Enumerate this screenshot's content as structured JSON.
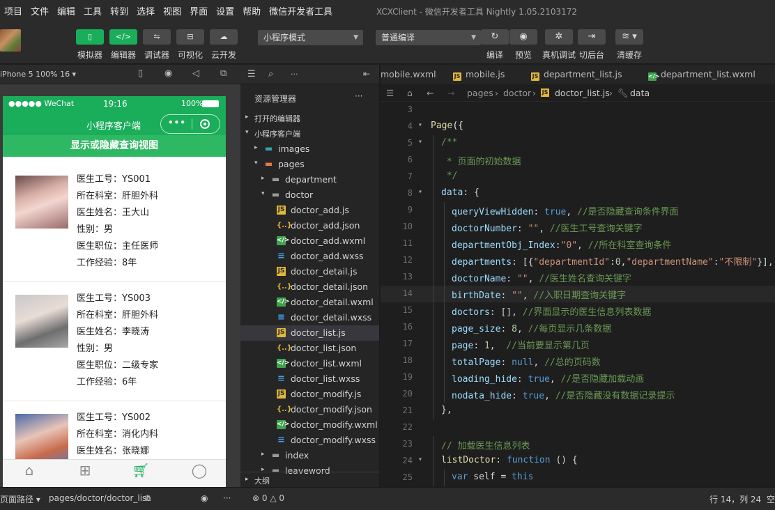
{
  "menu": {
    "items": [
      "项目",
      "文件",
      "编辑",
      "工具",
      "转到",
      "选择",
      "视图",
      "界面",
      "设置",
      "帮助",
      "微信开发者工具"
    ],
    "window_title": "XCXClient - 微信开发者工具 Nightly 1.05.2103172"
  },
  "toolbar": {
    "left_tools": [
      {
        "label": "模拟器",
        "icon": "phone-icon",
        "active": true
      },
      {
        "label": "编辑器",
        "icon": "code-icon",
        "active": true
      },
      {
        "label": "调试器",
        "icon": "debug-icon",
        "active": false
      },
      {
        "label": "可视化",
        "icon": "visual-icon",
        "active": false
      },
      {
        "label": "云开发",
        "icon": "cloud-icon",
        "active": false
      }
    ],
    "mode_select": "小程序模式",
    "compile_select": "普通编译",
    "right_tools": [
      {
        "label": "编译",
        "icon": "refresh-icon"
      },
      {
        "label": "预览",
        "icon": "eye-icon"
      },
      {
        "label": "真机调试",
        "icon": "bug-icon"
      },
      {
        "label": "切后台",
        "icon": "switch-icon"
      },
      {
        "label": "清缓存",
        "icon": "layers-icon"
      }
    ]
  },
  "simulator": {
    "device": "iPhone 5 100% 16 ▾",
    "status": {
      "carrier": "●●●●● WeChat",
      "time": "19:16",
      "battery": "100%"
    },
    "nav_title": "小程序客户端",
    "toggle_label": "显示或隐藏查询视图",
    "doctors": [
      {
        "lines": [
          "医生工号：YS001",
          "所在科室：肝胆外科",
          "医生姓名：王大山",
          "性别：男",
          "医生职位：主任医师",
          "工作经验：8年"
        ]
      },
      {
        "lines": [
          "医生工号：YS003",
          "所在科室：肝胆外科",
          "医生姓名：李晓涛",
          "性别：男",
          "医生职位：二级专家",
          "工作经验：6年"
        ]
      },
      {
        "lines": [
          "医生工号：YS002",
          "所在科室：消化内科",
          "医生姓名：张晓娜"
        ]
      }
    ]
  },
  "explorer": {
    "title": "资源管理器",
    "more": "···",
    "sections": {
      "open_editors": "打开的编辑器",
      "project": "小程序客户端",
      "outline": "大纲"
    },
    "tree": [
      {
        "name": "images",
        "type": "images",
        "depth": 1,
        "arrow": "▸"
      },
      {
        "name": "pages",
        "type": "pages",
        "depth": 1,
        "arrow": "▾"
      },
      {
        "name": "department",
        "type": "folder",
        "depth": 2,
        "arrow": "▸"
      },
      {
        "name": "doctor",
        "type": "folder-open",
        "depth": 2,
        "arrow": "▾"
      },
      {
        "name": "doctor_add.js",
        "type": "js",
        "depth": 3
      },
      {
        "name": "doctor_add.json",
        "type": "json",
        "depth": 3
      },
      {
        "name": "doctor_add.wxml",
        "type": "wxml",
        "depth": 3
      },
      {
        "name": "doctor_add.wxss",
        "type": "wxss",
        "depth": 3
      },
      {
        "name": "doctor_detail.js",
        "type": "js",
        "depth": 3
      },
      {
        "name": "doctor_detail.json",
        "type": "json",
        "depth": 3
      },
      {
        "name": "doctor_detail.wxml",
        "type": "wxml",
        "depth": 3
      },
      {
        "name": "doctor_detail.wxss",
        "type": "wxss",
        "depth": 3
      },
      {
        "name": "doctor_list.js",
        "type": "js",
        "depth": 3,
        "selected": true
      },
      {
        "name": "doctor_list.json",
        "type": "json",
        "depth": 3
      },
      {
        "name": "doctor_list.wxml",
        "type": "wxml",
        "depth": 3
      },
      {
        "name": "doctor_list.wxss",
        "type": "wxss",
        "depth": 3
      },
      {
        "name": "doctor_modify.js",
        "type": "js",
        "depth": 3
      },
      {
        "name": "doctor_modify.json",
        "type": "json",
        "depth": 3
      },
      {
        "name": "doctor_modify.wxml",
        "type": "wxml",
        "depth": 3
      },
      {
        "name": "doctor_modify.wxss",
        "type": "wxss",
        "depth": 3
      },
      {
        "name": "index",
        "type": "folder",
        "depth": 2,
        "arrow": "▸"
      },
      {
        "name": "leaveword",
        "type": "folder",
        "depth": 2,
        "arrow": "▸"
      }
    ]
  },
  "editor": {
    "tabs": [
      {
        "name": "mobile.wxml",
        "type": "wxml"
      },
      {
        "name": "mobile.js",
        "type": "js"
      },
      {
        "name": "department_list.js",
        "type": "js"
      },
      {
        "name": "department_list.wxml",
        "type": "wxml"
      }
    ],
    "breadcrumb": [
      "pages",
      "doctor",
      "doctor_list.js",
      "data"
    ],
    "lines": [
      {
        "n": "3",
        "tokens": []
      },
      {
        "n": "4",
        "fold": "▾",
        "tokens": [
          [
            "fn",
            "Page"
          ],
          [
            "pn",
            "({"
          ]
        ]
      },
      {
        "n": "5",
        "fold": "▾",
        "indent": 1,
        "tokens": [
          [
            "cm",
            "/**"
          ]
        ]
      },
      {
        "n": "6",
        "indent": 1,
        "tokens": [
          [
            "cm",
            " * 页面的初始数据"
          ]
        ]
      },
      {
        "n": "7",
        "indent": 1,
        "tokens": [
          [
            "cm",
            " */"
          ]
        ]
      },
      {
        "n": "8",
        "fold": "▾",
        "indent": 1,
        "tokens": [
          [
            "prop",
            "data"
          ],
          [
            "plain",
            ": {"
          ]
        ]
      },
      {
        "n": "9",
        "indent": 2,
        "tokens": [
          [
            "prop",
            "queryViewHidden"
          ],
          [
            "plain",
            ": "
          ],
          [
            "lit",
            "true"
          ],
          [
            "plain",
            ", "
          ],
          [
            "cm",
            "//是否隐藏查询条件界面"
          ]
        ]
      },
      {
        "n": "10",
        "indent": 2,
        "tokens": [
          [
            "prop",
            "doctorNumber"
          ],
          [
            "plain",
            ": "
          ],
          [
            "str",
            "\"\""
          ],
          [
            "plain",
            ", "
          ],
          [
            "cm",
            "//医生工号查询关键字"
          ]
        ]
      },
      {
        "n": "11",
        "indent": 2,
        "tokens": [
          [
            "prop",
            "departmentObj_Index"
          ],
          [
            "plain",
            ":"
          ],
          [
            "str",
            "\"0\""
          ],
          [
            "plain",
            ", "
          ],
          [
            "cm",
            "//所在科室查询条件"
          ]
        ]
      },
      {
        "n": "12",
        "indent": 2,
        "tokens": [
          [
            "prop",
            "departments"
          ],
          [
            "plain",
            ": [{"
          ],
          [
            "str",
            "\"departmentId\""
          ],
          [
            "plain",
            ":"
          ],
          [
            "num",
            "0"
          ],
          [
            "plain",
            ","
          ],
          [
            "str",
            "\"departmentName\""
          ],
          [
            "plain",
            ":"
          ],
          [
            "str",
            "\"不限制\""
          ],
          [
            "plain",
            "}],"
          ]
        ]
      },
      {
        "n": "13",
        "indent": 2,
        "tokens": [
          [
            "prop",
            "doctorName"
          ],
          [
            "plain",
            ": "
          ],
          [
            "str",
            "\"\""
          ],
          [
            "plain",
            ", "
          ],
          [
            "cm",
            "//医生姓名查询关键字"
          ]
        ]
      },
      {
        "n": "14",
        "indent": 2,
        "hl": true,
        "tokens": [
          [
            "prop",
            "birthDate"
          ],
          [
            "plain",
            ": "
          ],
          [
            "str",
            "\"\""
          ],
          [
            "plain",
            ", "
          ],
          [
            "cm",
            "//入职日期查询关键字"
          ]
        ]
      },
      {
        "n": "15",
        "indent": 2,
        "tokens": [
          [
            "prop",
            "doctors"
          ],
          [
            "plain",
            ": [], "
          ],
          [
            "cm",
            "//界面显示的医生信息列表数据"
          ]
        ]
      },
      {
        "n": "16",
        "indent": 2,
        "tokens": [
          [
            "prop",
            "page_size"
          ],
          [
            "plain",
            ": "
          ],
          [
            "num",
            "8"
          ],
          [
            "plain",
            ", "
          ],
          [
            "cm",
            "//每页显示几条数据"
          ]
        ]
      },
      {
        "n": "17",
        "indent": 2,
        "tokens": [
          [
            "prop",
            "page"
          ],
          [
            "plain",
            ": "
          ],
          [
            "num",
            "1"
          ],
          [
            "plain",
            ",  "
          ],
          [
            "cm",
            "//当前要显示第几页"
          ]
        ]
      },
      {
        "n": "18",
        "indent": 2,
        "tokens": [
          [
            "prop",
            "totalPage"
          ],
          [
            "plain",
            ": "
          ],
          [
            "lit",
            "null"
          ],
          [
            "plain",
            ", "
          ],
          [
            "cm",
            "//总的页码数"
          ]
        ]
      },
      {
        "n": "19",
        "indent": 2,
        "tokens": [
          [
            "prop",
            "loading_hide"
          ],
          [
            "plain",
            ": "
          ],
          [
            "lit",
            "true"
          ],
          [
            "plain",
            ", "
          ],
          [
            "cm",
            "//是否隐藏加载动画"
          ]
        ]
      },
      {
        "n": "20",
        "indent": 2,
        "tokens": [
          [
            "prop",
            "nodata_hide"
          ],
          [
            "plain",
            ": "
          ],
          [
            "lit",
            "true"
          ],
          [
            "plain",
            ", "
          ],
          [
            "cm",
            "//是否隐藏没有数据记录提示"
          ]
        ]
      },
      {
        "n": "21",
        "indent": 1,
        "tokens": [
          [
            "plain",
            "},"
          ]
        ]
      },
      {
        "n": "22",
        "tokens": []
      },
      {
        "n": "23",
        "indent": 1,
        "tokens": [
          [
            "cm",
            "// 加载医生信息列表"
          ]
        ]
      },
      {
        "n": "24",
        "fold": "▾",
        "indent": 1,
        "tokens": [
          [
            "fn",
            "listDoctor"
          ],
          [
            "plain",
            ": "
          ],
          [
            "kw",
            "function"
          ],
          [
            "plain",
            " () {"
          ]
        ]
      },
      {
        "n": "25",
        "indent": 2,
        "tokens": [
          [
            "kw",
            "var"
          ],
          [
            "plain",
            " self = "
          ],
          [
            "kw",
            "this"
          ]
        ]
      }
    ]
  },
  "statusbar": {
    "page_path_label": "页面路径 ▾",
    "page_path": "pages/doctor/doctor_list",
    "errors": "⊗ 0 △ 0",
    "position": "行 14，列 24",
    "spaces": "空"
  },
  "colors": {
    "wechat_green": "#1aad5a",
    "selected_row": "#37373d"
  }
}
